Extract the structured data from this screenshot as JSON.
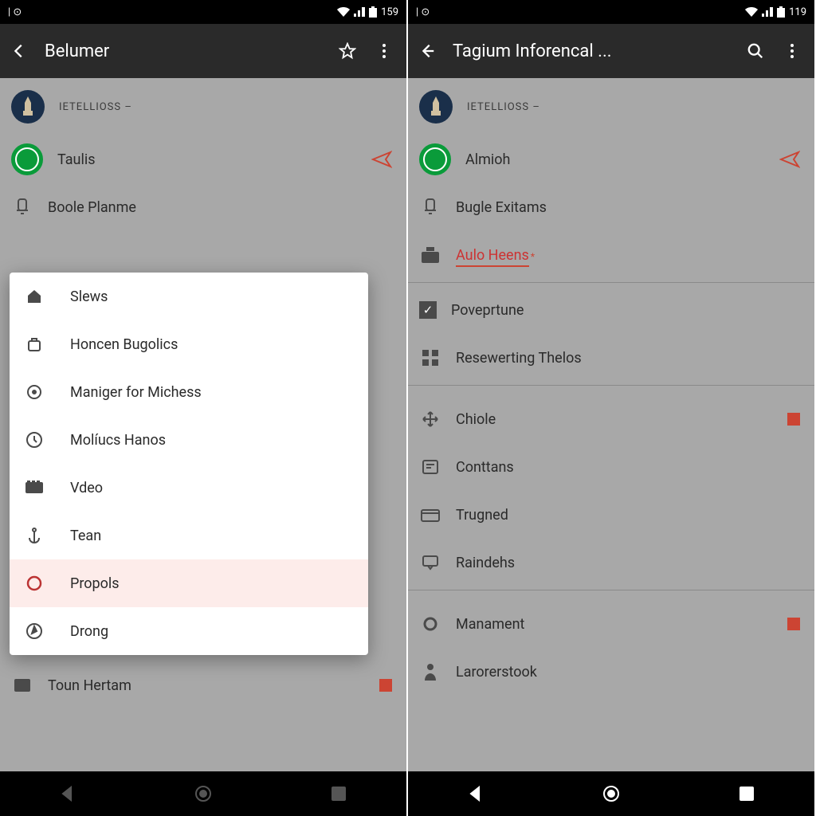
{
  "left": {
    "status": {
      "time": "159"
    },
    "appbar": {
      "title": "Belumer"
    },
    "header_label": "IETELLIOSS –",
    "rows": [
      {
        "label": "Taulis"
      },
      {
        "label": "Boole Planme"
      },
      {
        "label": "Toun Hertam"
      }
    ],
    "popup": [
      {
        "icon": "home",
        "label": "Slews"
      },
      {
        "icon": "bag",
        "label": "Honcen Bugolics"
      },
      {
        "icon": "target",
        "label": "Maniger for Michess"
      },
      {
        "icon": "clock",
        "label": "Molíucs Hanos"
      },
      {
        "icon": "video",
        "label": "Vdeo"
      },
      {
        "icon": "anchor",
        "label": "Tean"
      },
      {
        "icon": "circle",
        "label": "Propols",
        "sel": true
      },
      {
        "icon": "compass",
        "label": "Drong"
      }
    ]
  },
  "right": {
    "status": {
      "time": "119"
    },
    "appbar": {
      "title": "Tagium Inforencal ..."
    },
    "header_label": "IETELLIOSS –",
    "rows": [
      {
        "icon": "av",
        "label": "Almioh",
        "end": "plane"
      },
      {
        "icon": "bell",
        "label": "Bugle Exitams"
      },
      {
        "icon": "box",
        "label": "Aulo Heens",
        "mark": true
      },
      {
        "icon": "check",
        "label": "Poveprtune"
      },
      {
        "icon": "grid",
        "label": "Resewerting Thelos"
      },
      {
        "icon": "move",
        "label": "Chiole",
        "end": "box"
      },
      {
        "icon": "card",
        "label": "Conttans"
      },
      {
        "icon": "folder",
        "label": "Trugned"
      },
      {
        "icon": "chat",
        "label": "Raindehs"
      },
      {
        "icon": "ring",
        "label": "Manament",
        "end": "box"
      },
      {
        "icon": "person",
        "label": "Larorerstook"
      }
    ]
  }
}
